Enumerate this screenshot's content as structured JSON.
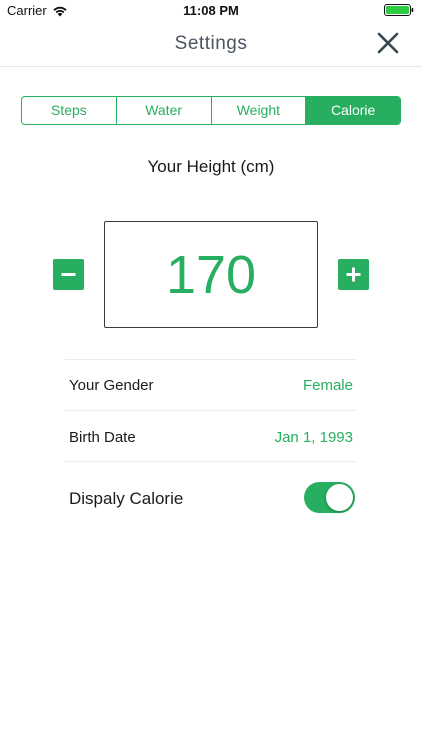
{
  "status_bar": {
    "carrier": "Carrier",
    "time": "11:08 PM",
    "wifi_icon": "wifi-icon",
    "battery_icon": "battery-icon"
  },
  "nav": {
    "title": "Settings",
    "close_icon": "close-icon"
  },
  "tabs": [
    {
      "label": "Steps",
      "selected": false
    },
    {
      "label": "Water",
      "selected": false
    },
    {
      "label": "Weight",
      "selected": false
    },
    {
      "label": "Calorie",
      "selected": true
    }
  ],
  "height": {
    "label": "Your Height (cm)",
    "value": "170",
    "minus_icon": "minus-icon",
    "plus_icon": "plus-icon"
  },
  "settings": {
    "gender_label": "Your Gender",
    "gender_value": "Female",
    "birth_label": "Birth Date",
    "birth_value": "Jan 1, 1993",
    "display_calorie_label": "Dispaly Calorie",
    "display_calorie_on": true
  },
  "colors": {
    "accent": "#27ae60",
    "title": "#4a5560"
  }
}
